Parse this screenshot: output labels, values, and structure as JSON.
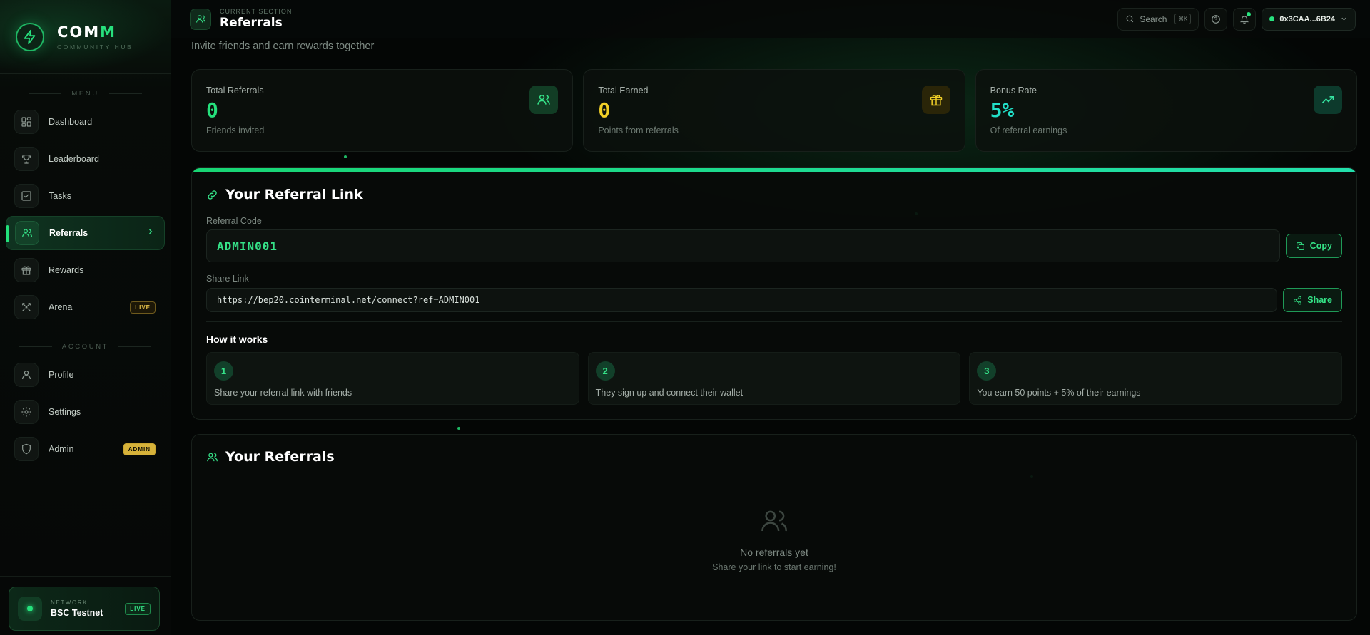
{
  "brand": {
    "name_prefix": "COM",
    "name_suffix": "M",
    "subtitle": "COMMUNITY HUB"
  },
  "sidebar": {
    "menu_label": "MENU",
    "menu_items": [
      {
        "label": "Dashboard",
        "icon": "dashboard-icon"
      },
      {
        "label": "Leaderboard",
        "icon": "trophy-icon"
      },
      {
        "label": "Tasks",
        "icon": "tasks-icon"
      },
      {
        "label": "Referrals",
        "icon": "users-icon",
        "active": true
      },
      {
        "label": "Rewards",
        "icon": "gift-icon"
      },
      {
        "label": "Arena",
        "icon": "swords-icon",
        "badge": "LIVE"
      }
    ],
    "account_label": "ACCOUNT",
    "account_items": [
      {
        "label": "Profile",
        "icon": "user-icon"
      },
      {
        "label": "Settings",
        "icon": "gear-icon"
      },
      {
        "label": "Admin",
        "icon": "shield-icon",
        "badge": "ADMIN"
      }
    ],
    "network": {
      "label": "NETWORK",
      "value": "BSC Testnet",
      "badge": "LIVE"
    }
  },
  "topbar": {
    "caption": "CURRENT SECTION",
    "title": "Referrals",
    "search_label": "Search",
    "search_shortcut": "⌘K",
    "wallet": "0x3CAA...6B24"
  },
  "page": {
    "subtitle": "Invite friends and earn rewards together"
  },
  "stats": [
    {
      "label": "Total Referrals",
      "value": "0",
      "sub": "Friends invited",
      "color": "#25e07c",
      "icon": "users-icon"
    },
    {
      "label": "Total Earned",
      "value": "0",
      "sub": "Points from referrals",
      "color": "#f2d027",
      "icon": "gift-icon"
    },
    {
      "label": "Bonus Rate",
      "value": "5%",
      "sub": "Of referral earnings",
      "color": "#22e0c8",
      "icon": "trending-up-icon"
    }
  ],
  "referral_link": {
    "title": "Your Referral Link",
    "code_label": "Referral Code",
    "code": "ADMIN001",
    "copy_label": "Copy",
    "share_label": "Share Link",
    "share_url": "https://bep20.cointerminal.net/connect?ref=ADMIN001",
    "share_button": "Share",
    "how_title": "How it works",
    "steps": [
      {
        "num": "1",
        "text": "Share your referral link with friends"
      },
      {
        "num": "2",
        "text": "They sign up and connect their wallet"
      },
      {
        "num": "3",
        "text": "You earn 50 points + 5% of their earnings"
      }
    ]
  },
  "referrals": {
    "title": "Your Referrals",
    "empty_title": "No referrals yet",
    "empty_sub": "Share your link to start earning!"
  },
  "colors": {
    "accent": "#25e07c",
    "accent_dark": "#0f3320",
    "yellow": "#f2d027",
    "teal": "#22e0c8"
  }
}
